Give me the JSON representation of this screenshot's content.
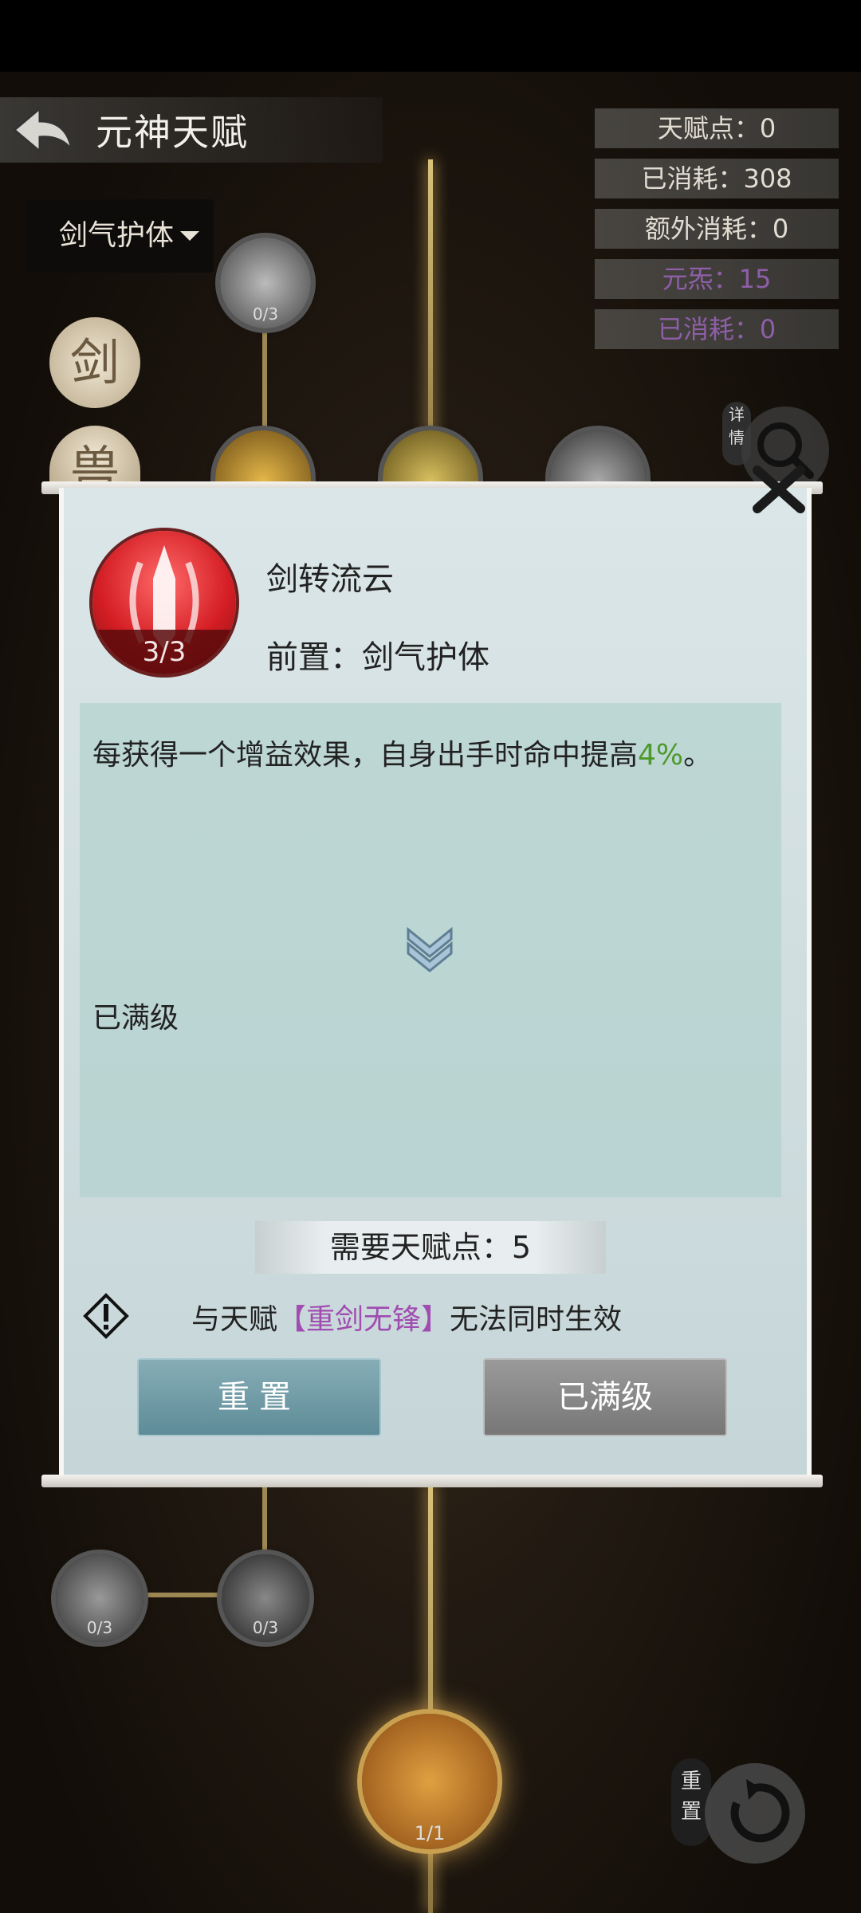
{
  "header": {
    "title": "元神天赋"
  },
  "dropdown": {
    "selected": "剑气护体"
  },
  "stats": [
    {
      "label": "天赋点：0"
    },
    {
      "label": "已消耗：308"
    },
    {
      "label": "额外消耗：0"
    },
    {
      "label": "元炁：15"
    },
    {
      "label": "已消耗：0"
    }
  ],
  "side_tags": {
    "detail": "详情",
    "reset": "重置"
  },
  "tree": {
    "medals": [
      "剑",
      "兽"
    ],
    "nodes": [
      {
        "count": "0/3"
      },
      {
        "count": "0/3"
      },
      {
        "count": "0/3"
      },
      {
        "count": "1/1"
      }
    ]
  },
  "modal": {
    "skill_level": "3/3",
    "skill_name": "剑转流云",
    "prerequisite": "前置：剑气护体",
    "description_pre": "每获得一个增益效果，自身出手时命中提高",
    "description_value": "4%",
    "description_post": "。",
    "max_level_note": "已满级",
    "required_points": "需要天赋点：5",
    "conflict_pre": "与天赋",
    "conflict_skill": "【重剑无锋】",
    "conflict_post": "无法同时生效",
    "reset_button": "重置",
    "max_button": "已满级"
  },
  "colors": {
    "accent_green": "#4c9a2a",
    "conflict_purple": "#a04cb0",
    "reset_button": "#6e97a2"
  }
}
